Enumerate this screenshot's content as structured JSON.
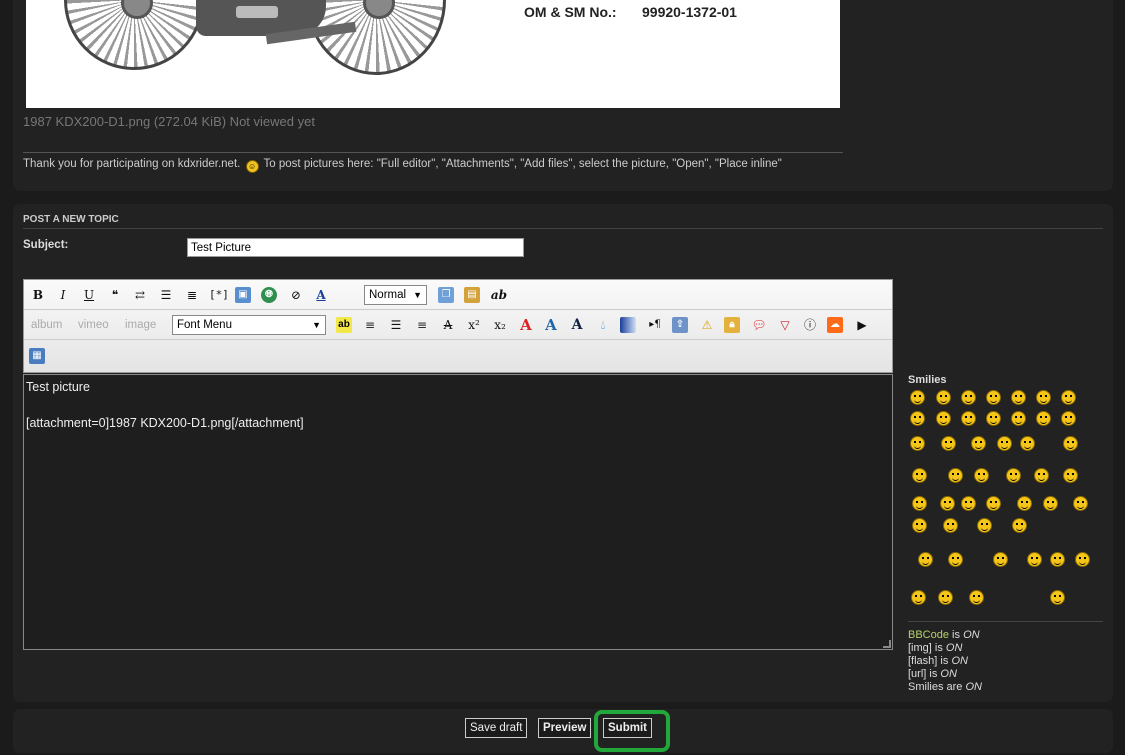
{
  "attachment": {
    "om_label": "OM & SM No.:",
    "om_value": "99920-1372-01",
    "caption": "1987 KDX200-D1.png (272.04 KiB) Not viewed yet"
  },
  "notice": {
    "text_before": "Thank you for participating on kdxrider.net.",
    "text_after": "To post pictures here: \"Full editor\", \"Attachments\", \"Add files\", select the picture, \"Open\", \"Place inline\""
  },
  "post": {
    "section_title": "POST A NEW TOPIC",
    "subject_label": "Subject:",
    "subject_value": "Test Picture",
    "message": "Test picture\n\n[attachment=0]1987 KDX200-D1.png[/attachment]"
  },
  "toolbar": {
    "bold": "B",
    "italic": "I",
    "underline": "U",
    "size_select": "Normal",
    "font_select": "Font Menu",
    "album": "album",
    "vimeo": "vimeo",
    "image": "image",
    "replace": "ab",
    "superscript": "x²",
    "subscript": "x₂"
  },
  "smilies": {
    "title": "Smilies"
  },
  "status": {
    "bbcode_label": "BBCode",
    "bbcode_state": "ON",
    "img_label": "[img]",
    "img_state": "ON",
    "flash_label": "[flash]",
    "flash_state": "ON",
    "url_label": "[url]",
    "url_state": "ON",
    "smilies_label": "Smilies are",
    "smilies_state": "ON",
    "is_word": "is"
  },
  "buttons": {
    "save_draft": "Save draft",
    "preview": "Preview",
    "submit": "Submit"
  },
  "colors": {
    "accent_green": "#22a83a",
    "bbcode_link": "#b5d26b"
  }
}
